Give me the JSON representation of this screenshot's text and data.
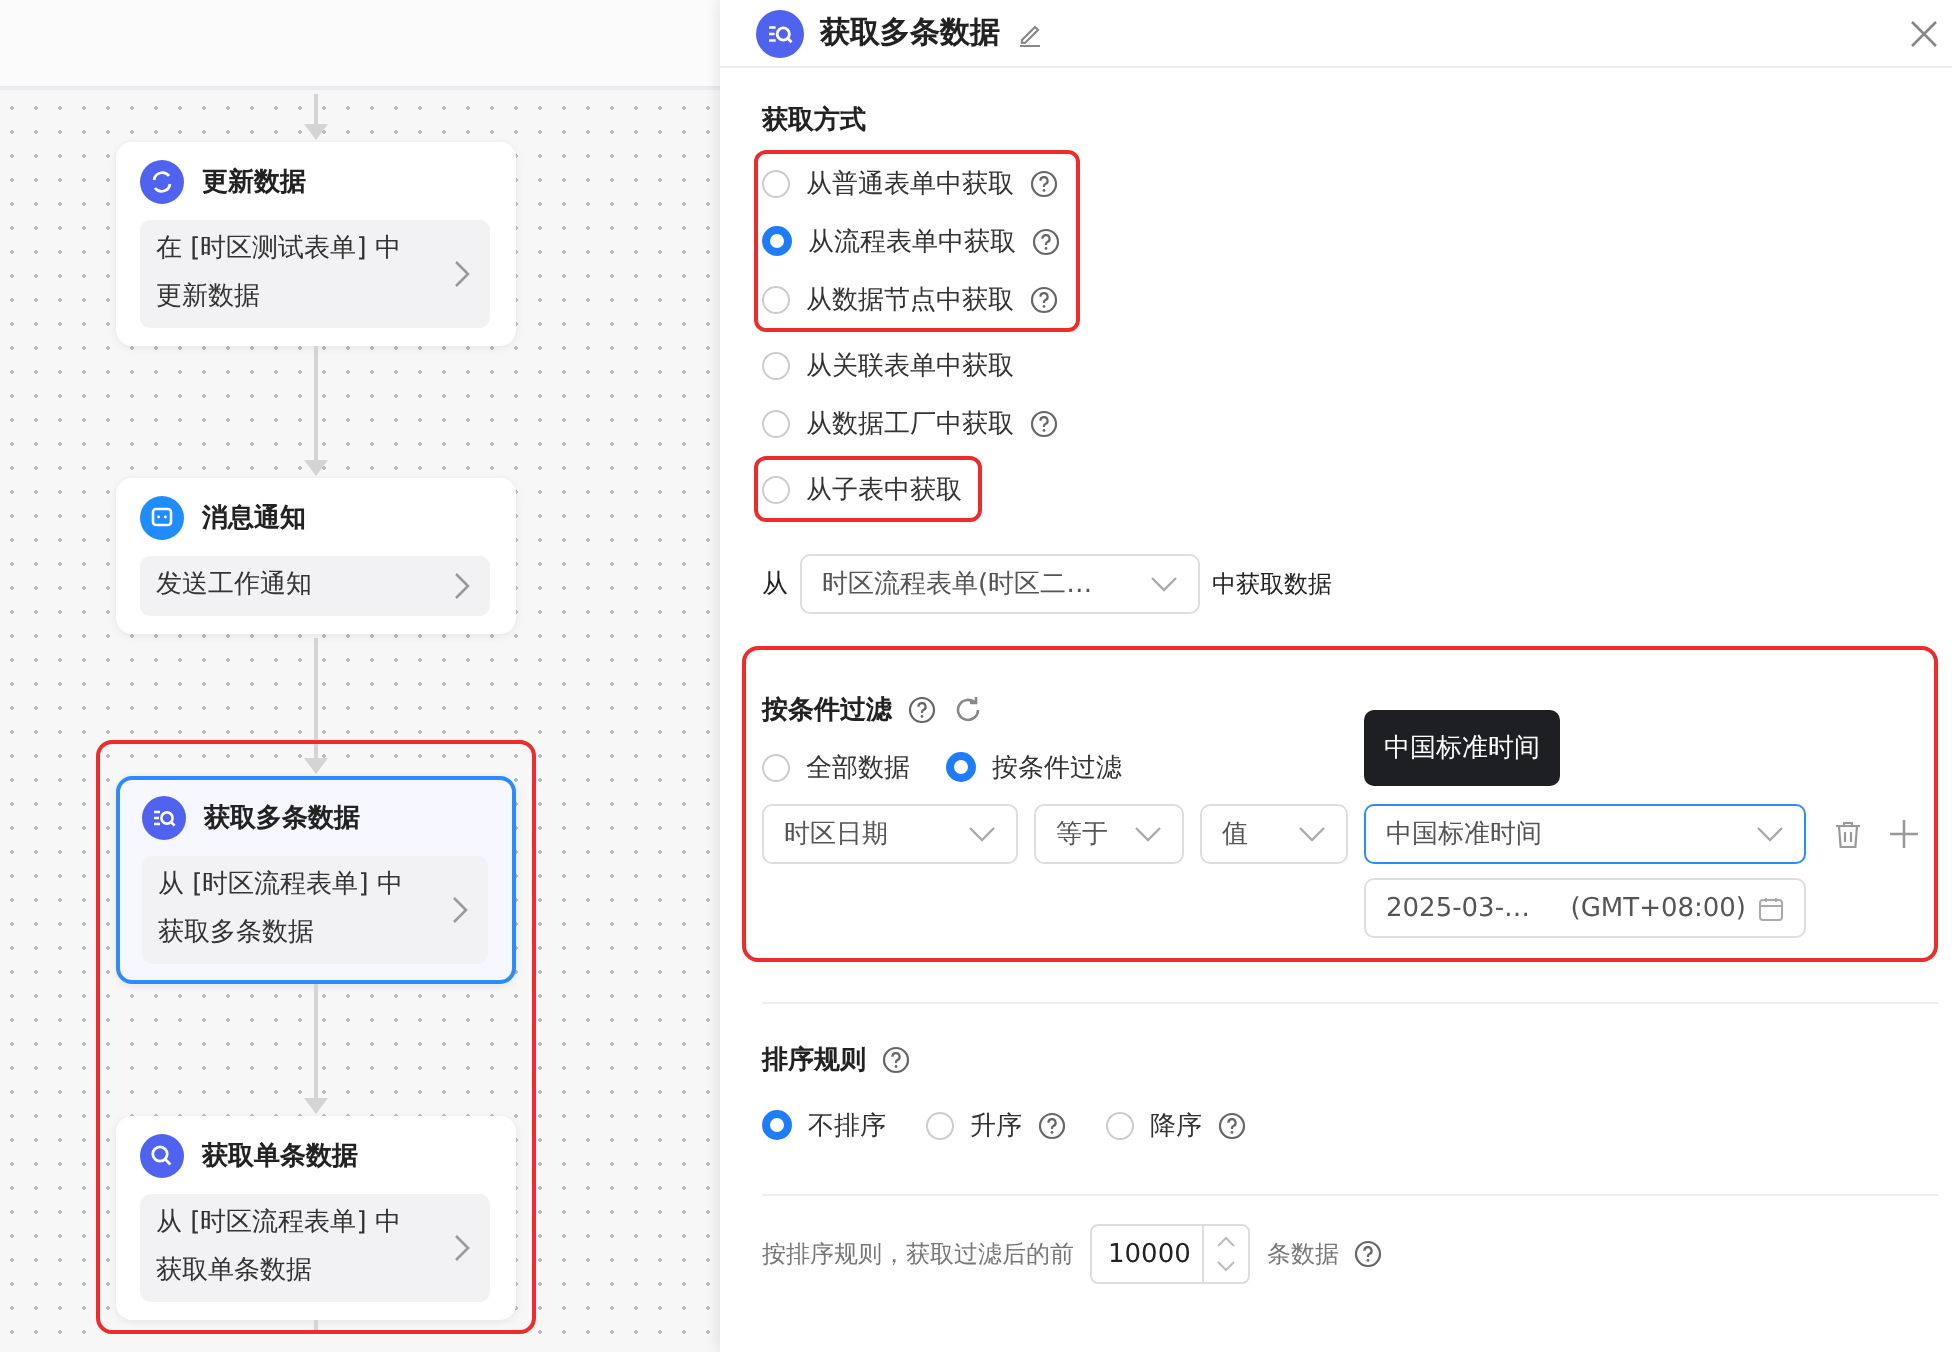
{
  "flow": {
    "sections": [
      {
        "highlighted": false,
        "nodes": [
          {
            "title": "更新数据",
            "desc": "在 [时区测试表单] 中更新数据",
            "selected": false
          },
          {
            "title": "消息通知",
            "desc": "发送工作通知",
            "selected": false
          }
        ]
      },
      {
        "highlighted": true,
        "nodes": [
          {
            "title": "获取多条数据",
            "desc": "从 [时区流程表单] 中获取多条数据",
            "selected": true
          },
          {
            "title": "获取单条数据",
            "desc": "从 [时区流程表单] 中获取单条数据",
            "selected": false
          }
        ]
      }
    ]
  },
  "panel": {
    "title": "获取多条数据",
    "method": {
      "label": "获取方式",
      "groups": [
        {
          "highlighted": true,
          "options": [
            {
              "label": "从普通表单中获取",
              "selected": false,
              "help": true
            },
            {
              "label": "从流程表单中获取",
              "selected": true,
              "help": true
            },
            {
              "label": "从数据节点中获取",
              "selected": false,
              "help": true
            }
          ]
        },
        {
          "highlighted": false,
          "options": [
            {
              "label": "从关联表单中获取",
              "selected": false,
              "help": false
            },
            {
              "label": "从数据工厂中获取",
              "selected": false,
              "help": true
            }
          ]
        },
        {
          "highlighted": true,
          "options": [
            {
              "label": "从子表中获取",
              "selected": false,
              "help": false
            }
          ]
        }
      ]
    },
    "source": {
      "prefix": "从",
      "value": "时区流程表单(时区二…",
      "suffix": "中获取数据"
    },
    "filter": {
      "label": "按条件过滤",
      "highlighted": true,
      "modes": [
        {
          "label": "全部数据",
          "selected": false
        },
        {
          "label": "按条件过滤",
          "selected": true
        }
      ],
      "field": "时区日期",
      "operator": "等于",
      "value_type": "值",
      "timezone": "中国标准时间",
      "tooltip": "中国标准时间",
      "date": "2025-03-…",
      "offset": "(GMT+08:00)"
    },
    "sort": {
      "label": "排序规则",
      "options": [
        {
          "label": "不排序",
          "selected": true,
          "help": false
        },
        {
          "label": "升序",
          "selected": false,
          "help": true
        },
        {
          "label": "降序",
          "selected": false,
          "help": true
        }
      ]
    },
    "limit": {
      "prefix": "按排序规则，获取过滤后的前",
      "value": "10000",
      "suffix": "条数据"
    }
  }
}
